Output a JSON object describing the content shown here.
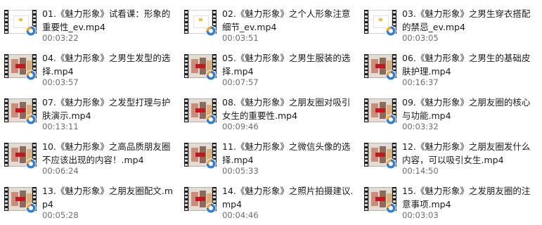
{
  "files": [
    {
      "name": "01.《魅力形象》试看课：形象的重要性_ev.mp4",
      "duration": "00:03:22",
      "thumb": "blank"
    },
    {
      "name": "02.《魅力形象》之个人形象注意细节_ev.mp4",
      "duration": "00:03:51",
      "thumb": "blank"
    },
    {
      "name": "03.《魅力形象》之男生穿衣搭配的禁忌_ev.mp4",
      "duration": "00:03:05",
      "thumb": "blank"
    },
    {
      "name": "04.《魅力形象》之男生发型的选择.mp4",
      "duration": "00:03:57",
      "thumb": "photo"
    },
    {
      "name": "05.《魅力形象》之男生服装的选择.mp4",
      "duration": "00:07:57",
      "thumb": "photo"
    },
    {
      "name": "06.《魅力形象》之男生的基础皮肤护理.mp4",
      "duration": "00:16:37",
      "thumb": "photo"
    },
    {
      "name": "07.《魅力形象》之发型打理与护肤演示.mp4",
      "duration": "00:13:11",
      "thumb": "photo"
    },
    {
      "name": "08.《魅力形象》之朋友圈对吸引女生的重要性.mp4",
      "duration": "00:09:46",
      "thumb": "photo"
    },
    {
      "name": "09.《魅力形象》之朋友圈的核心与功能.mp4",
      "duration": "00:03:32",
      "thumb": "photo"
    },
    {
      "name": "10.《魅力形象》之高品质朋友圈不应该出现的内容！.mp4",
      "duration": "00:06:24",
      "thumb": "photo"
    },
    {
      "name": "11.《魅力形象》之微信头像的选择.mp4",
      "duration": "00:05:33",
      "thumb": "photo"
    },
    {
      "name": "12.《魅力形象》之朋友圈发什么内容，可以吸引女生.mp4",
      "duration": "00:14:50",
      "thumb": "photo"
    },
    {
      "name": "13.《魅力形象》之朋友圈配文.mp4",
      "duration": "00:05:28",
      "thumb": "photo"
    },
    {
      "name": "14.《魅力形象》之照片拍摄建议.mp4",
      "duration": "00:04:46",
      "thumb": "photo"
    },
    {
      "name": "15.《魅力形象》之发朋友圈的注意事项.mp4",
      "duration": "00:03:03",
      "thumb": "photo"
    }
  ],
  "icons": {
    "thumbnail": "video-file-icon",
    "overlay": "media-player-icon"
  },
  "colors": {
    "title": "#1a1a1a",
    "duration": "#6d6d6d",
    "overlay_blue": "#2f7fd8"
  }
}
